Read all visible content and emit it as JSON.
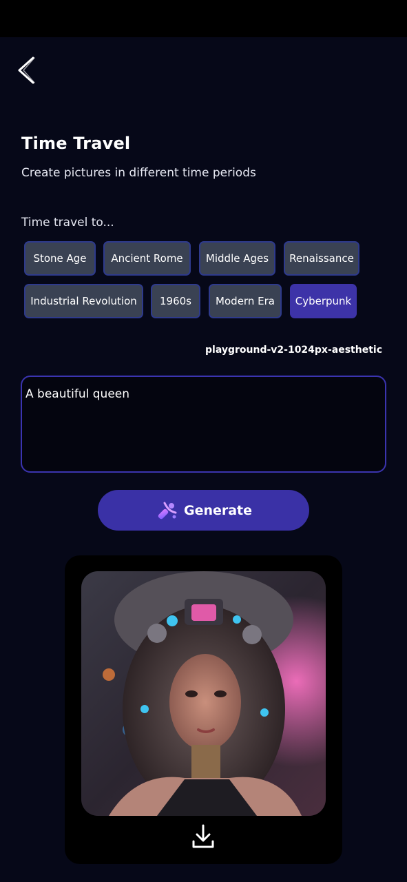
{
  "header": {
    "back_icon": "chevron-left-icon"
  },
  "page": {
    "title": "Time Travel",
    "subtitle": "Create pictures in different time periods",
    "section_label": "Time travel to..."
  },
  "eras": [
    {
      "label": "Stone Age",
      "selected": false
    },
    {
      "label": "Ancient Rome",
      "selected": false
    },
    {
      "label": "Middle Ages",
      "selected": false
    },
    {
      "label": "Renaissance",
      "selected": false
    },
    {
      "label": "Industrial Revolution",
      "selected": false
    },
    {
      "label": "1960s",
      "selected": false
    },
    {
      "label": "Modern Era",
      "selected": false
    },
    {
      "label": "Cyberpunk",
      "selected": true
    }
  ],
  "model": {
    "name": "playground-v2-1024px-aesthetic"
  },
  "prompt": {
    "value": "A beautiful queen"
  },
  "generate": {
    "label": "Generate",
    "icon": "magic-wand-icon"
  },
  "result": {
    "download_icon": "download-icon"
  },
  "colors": {
    "background": "#060818",
    "chip": "#3a4253",
    "chip_selected": "#3d33a8",
    "accent": "#3a31a6",
    "input_border": "#3b34b0"
  }
}
